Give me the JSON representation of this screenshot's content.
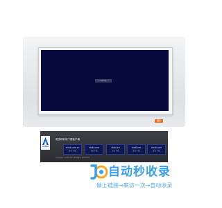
{
  "player": {
    "overlay_label": "Loading...",
    "stand_caption": "",
    "button_label": "更多"
  },
  "footer": {
    "heading": "更多精彩请下载客户端",
    "logo_text": "LIANDA",
    "buttons": [
      {
        "label": "cbdd.com.cn",
        "sub": "正在下载"
      },
      {
        "label": "cbdd.com",
        "sub": "正在下载"
      },
      {
        "label": "cbdd.cn",
        "sub": "正在下载"
      },
      {
        "label": "cbdd.net",
        "sub": "正在下载"
      },
      {
        "label": "cbdd.com",
        "sub": "正在下载"
      }
    ],
    "copyright": "Copyright © 2005-2015 All Rights Reserved."
  },
  "brand": {
    "name": "自动秒收录",
    "slogan": "做上链接→来访一次→自动收录",
    "colors": {
      "primary": "#3aa0e8",
      "accent": "#f26a1b"
    }
  }
}
